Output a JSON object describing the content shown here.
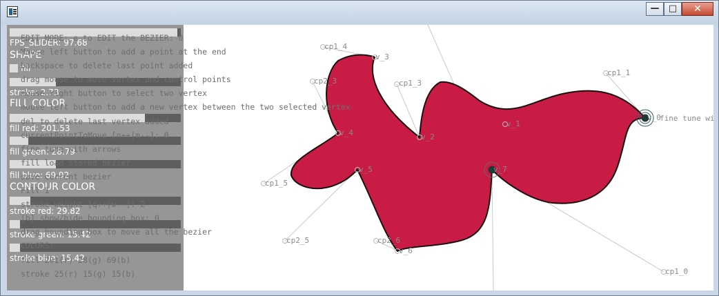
{
  "help_lines": [
    "EDIT MODE: e to EDIT the BEZIER: 0",
    "Mouse left button to add a point at the end",
    "backspace to delete last point added",
    "drag mouse to move vertex and control points",
    "mouse right button to select two vertex",
    "mouse left button to add a new vertex between the two selected vertex",
    "del to delete last vertex added",
    "currentPointToMove [n++|m--]: 0",
    "fine tune with arrows",
    "fill load stored bezier",
    "save current bezier",
    "Fill 1",
    "stroke weight [q++|w--]: 2",
    "[b] show/hide bounding box: 0",
    "drag bounding box to move all the bezier",
    "COLORS:",
    "fill 201(r) 28(g) 69(b)",
    "stroke 25(r) 15(g) 15(b)"
  ],
  "panel": {
    "fps_label": "FPS_SLIDER: 97.68",
    "fps_value": 0.98,
    "shape_header": "SHAPE",
    "fill_toggle_label": "fill",
    "stroke_label": "stroke: 2.73",
    "stroke_value": 0.27,
    "fill_color_header": "FILL COLOR",
    "fill_red_label": "fill red: 201.53",
    "fill_red_value": 0.79,
    "fill_green_label": "fill green: 28.79",
    "fill_green_value": 0.11,
    "fill_blue_label": "fill blue: 69.92",
    "fill_blue_value": 0.27,
    "contour_color_header": "CONTOUR COLOR",
    "stroke_red_label": "stroke red: 29.82",
    "stroke_red_value": 0.12,
    "stroke_green_label": "stroke green: 15.42",
    "stroke_green_value": 0.06,
    "stroke_blue_label": "stroke blue: 15.42",
    "stroke_blue_value": 0.06
  },
  "point_labels": {
    "cp1_4": "cp1_4",
    "v_3": "v_3",
    "cp2_3": "cp2_3",
    "cp1_3": "cp1_3",
    "cp1_1": "cp1_1",
    "v_1": "v_1",
    "v_4": "v_4",
    "v_2": "v_2",
    "v_5": "v_5",
    "v_7": "v_7",
    "cp1_5": "cp1_5",
    "cp2_5": "cp2_5",
    "cp2_6": "cp2_6",
    "v_6": "v_6",
    "cp1_0": "cp1_0",
    "v_0": "v_0",
    "fine_tune": "fine tune with"
  },
  "colors": {
    "fill": "#c91c45",
    "stroke": "#190f0f"
  }
}
